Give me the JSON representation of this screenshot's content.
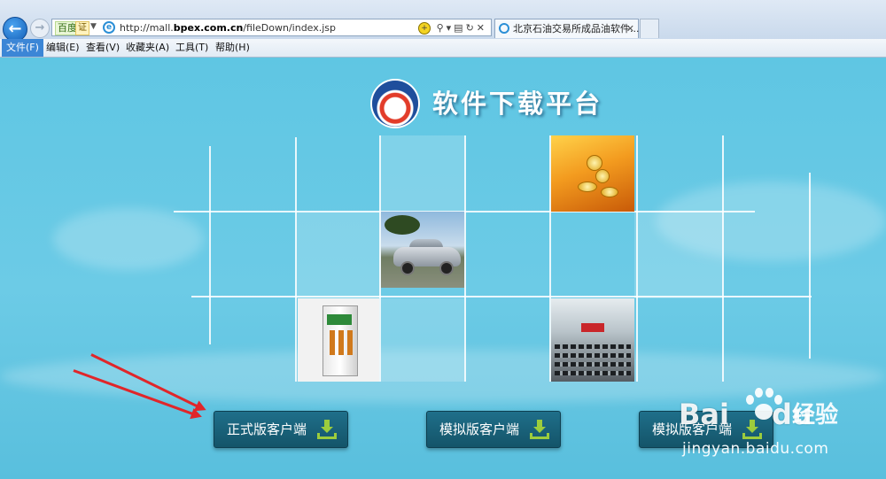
{
  "browser": {
    "address": {
      "search_engine_tag": "百度",
      "cert_tag": "证",
      "url_prefix": "http://mall.",
      "url_domain": "bpex.com.cn",
      "url_path": "/fileDown/index.jsp"
    },
    "tab": {
      "title": "北京石油交易所成品油软件..."
    },
    "menu": [
      {
        "label": "文件(F)"
      },
      {
        "label": "编辑(E)"
      },
      {
        "label": "查看(V)"
      },
      {
        "label": "收藏夹(A)"
      },
      {
        "label": "工具(T)"
      },
      {
        "label": "帮助(H)"
      }
    ]
  },
  "page": {
    "title": "软件下载平台",
    "buttons": {
      "formal": "正式版客户端",
      "sim1": "模拟版客户端",
      "sim2": "模拟版客户端"
    },
    "accent_arrow_color": "#e0262a",
    "button_color": "#1a6178"
  },
  "watermark": {
    "logo": "Bai",
    "logo_suffix": "du",
    "cn": "经验",
    "url": "jingyan.baidu.com"
  }
}
